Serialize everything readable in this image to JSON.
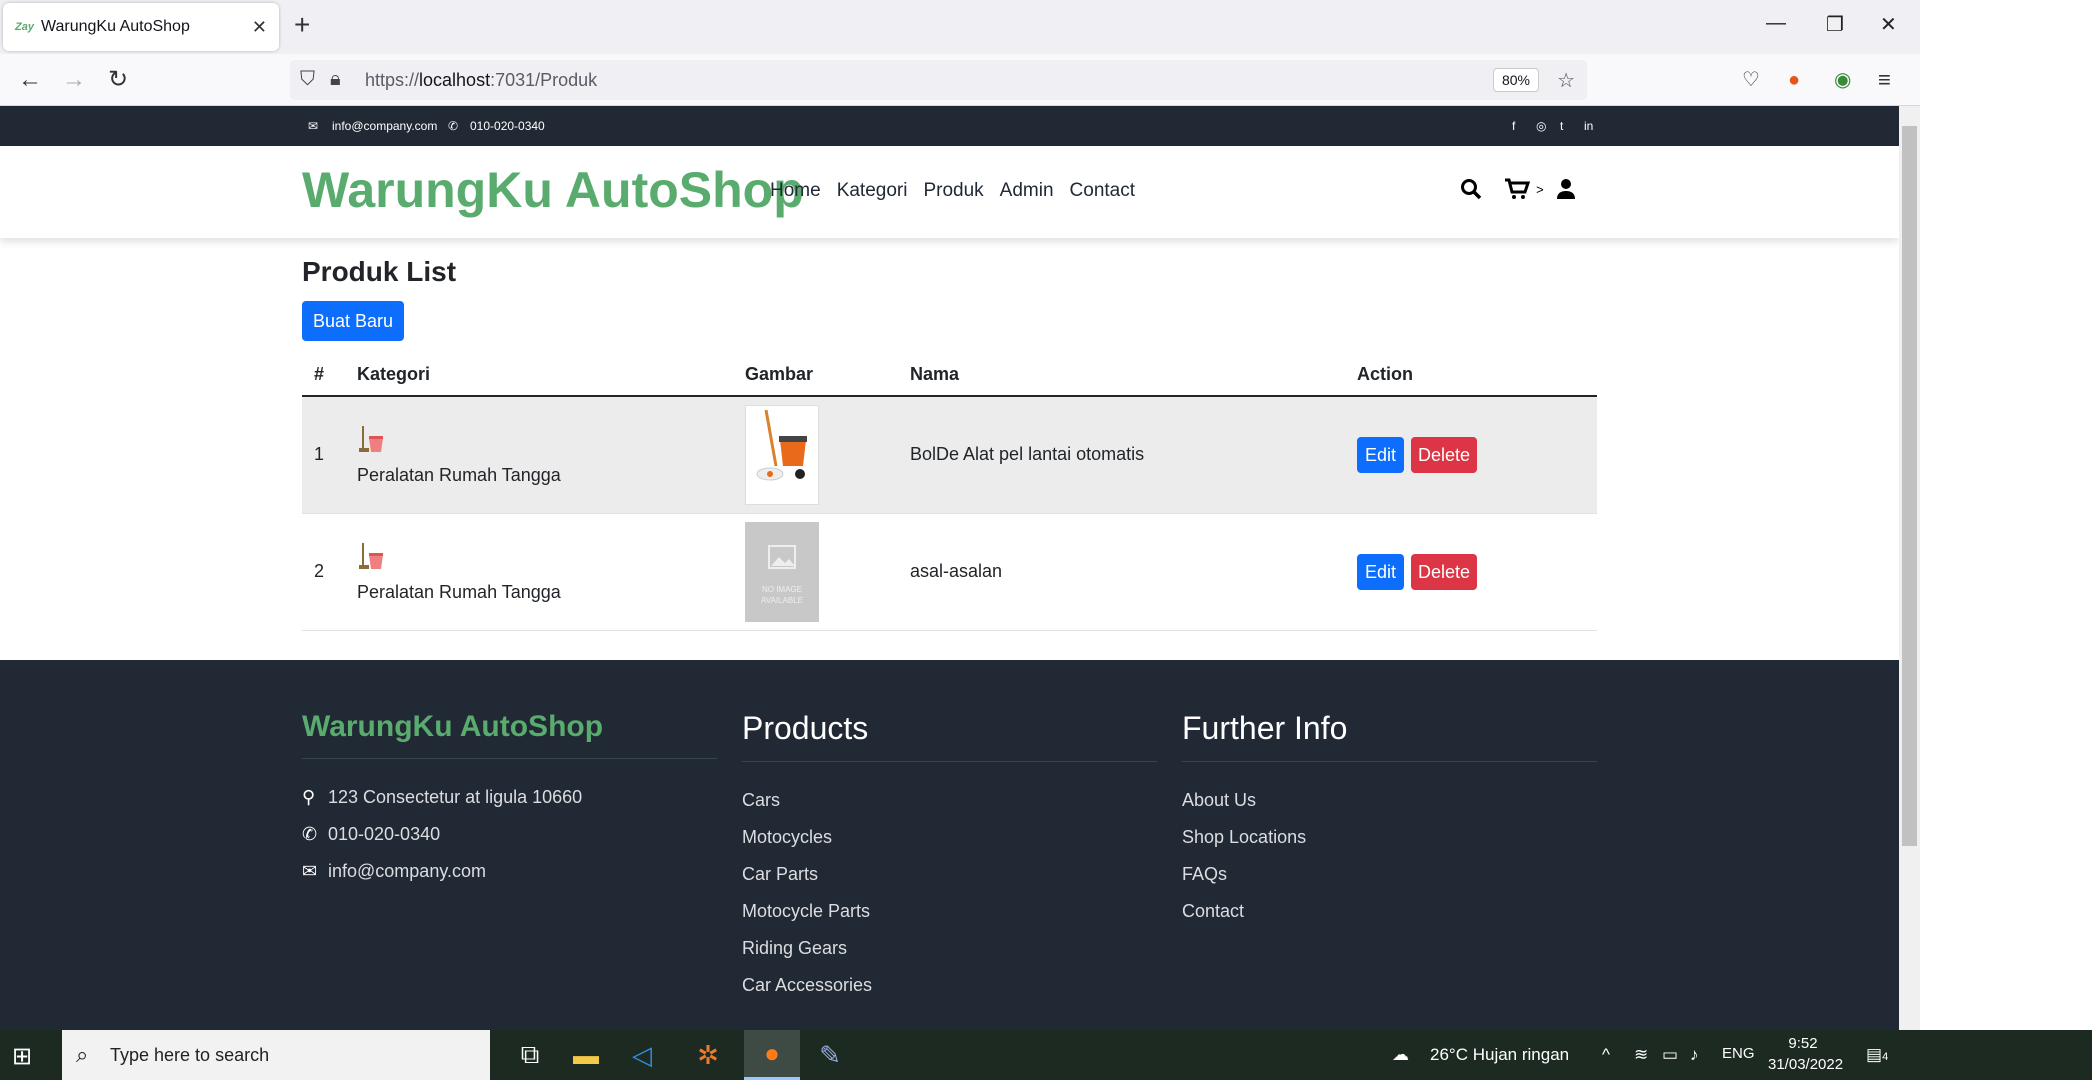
{
  "browser": {
    "tab_title": "WarungKu AutoShop",
    "tab_favicon": "Zay",
    "url_prefix": "https://",
    "url_host": "localhost",
    "url_rest": ":7031/Produk",
    "zoom": "80%"
  },
  "topbar": {
    "email": "info@company.com",
    "phone": "010-020-0340"
  },
  "nav": {
    "brand": "WarungKu AutoShop",
    "links": [
      "Home",
      "Kategori",
      "Produk",
      "Admin",
      "Contact"
    ],
    "cart_badge": ">"
  },
  "main": {
    "title": "Produk List",
    "create_label": "Buat Baru",
    "columns": [
      "#",
      "Kategori",
      "Gambar",
      "Nama",
      "Action"
    ],
    "rows": [
      {
        "num": "1",
        "kategori": "Peralatan Rumah Tangga",
        "nama": "BolDe Alat pel lantai otomatis",
        "image": "mop-bucket",
        "edit": "Edit",
        "delete": "Delete"
      },
      {
        "num": "2",
        "kategori": "Peralatan Rumah Tangga",
        "nama": "asal-asalan",
        "image": "no-image",
        "noimg_line1": "NO IMAGE",
        "noimg_line2": "AVAILABLE",
        "edit": "Edit",
        "delete": "Delete"
      }
    ]
  },
  "footer": {
    "brand": "WarungKu AutoShop",
    "address": "123 Consectetur at ligula 10660",
    "phone": "010-020-0340",
    "email": "info@company.com",
    "products_title": "Products",
    "products": [
      "Cars",
      "Motocycles",
      "Car Parts",
      "Motocycle Parts",
      "Riding Gears",
      "Car Accessories"
    ],
    "info_title": "Further Info",
    "info": [
      "About Us",
      "Shop Locations",
      "FAQs",
      "Contact"
    ]
  },
  "taskbar": {
    "search_placeholder": "Type here to search",
    "weather": "26°C  Hujan ringan",
    "lang": "ENG",
    "time": "9:52",
    "date": "31/03/2022",
    "notif_count": "4"
  },
  "colors": {
    "brand": "#59ab6e",
    "dark": "#212934",
    "primary": "#0d6efd",
    "danger": "#dc3545"
  }
}
